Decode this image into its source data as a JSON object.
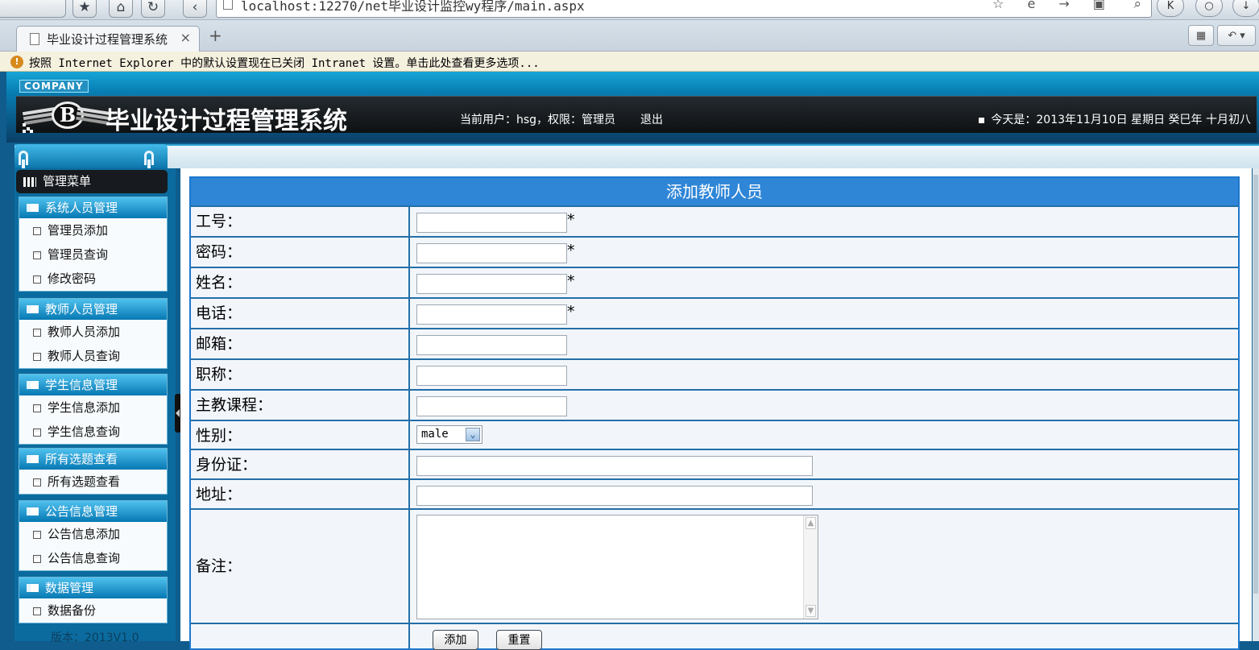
{
  "browser": {
    "url": "localhost:12270/net毕业设计监控wy程序/main.aspx",
    "tab_title": "毕业设计过程管理系统",
    "tab_close": "×",
    "new_tab": "+",
    "infobar_text": "按照 Internet Explorer 中的默认设置现在已关闭 Intranet 设置。单击此处查看更多选项..."
  },
  "header": {
    "company": "COMPANY",
    "logo_letter": "B",
    "title": "毕业设计过程管理系统",
    "user_info": "当前用户：hsg，权限：管理员",
    "logout": "退出",
    "date": "今天是：2013年11月10日 星期日 癸巳年 十月初八"
  },
  "sidebar": {
    "root": "管理菜单",
    "sections": [
      {
        "title": "系统人员管理",
        "items": [
          "管理员添加",
          "管理员查询",
          "修改密码"
        ]
      },
      {
        "title": "教师人员管理",
        "items": [
          "教师人员添加",
          "教师人员查询"
        ]
      },
      {
        "title": "学生信息管理",
        "items": [
          "学生信息添加",
          "学生信息查询"
        ]
      },
      {
        "title": "所有选题查看",
        "items": [
          "所有选题查看"
        ]
      },
      {
        "title": "公告信息管理",
        "items": [
          "公告信息添加",
          "公告信息查询"
        ]
      },
      {
        "title": "数据管理",
        "items": [
          "数据备份"
        ]
      }
    ],
    "version": "版本：2013V1.0"
  },
  "form": {
    "title": "添加教师人员",
    "fields": {
      "gonghao": {
        "label": "工号：",
        "required": "*"
      },
      "mima": {
        "label": "密码：",
        "required": "*"
      },
      "xingming": {
        "label": "姓名：",
        "required": "*"
      },
      "dianhua": {
        "label": "电话：",
        "required": "*"
      },
      "youxiang": {
        "label": "邮箱："
      },
      "zhicheng": {
        "label": "职称："
      },
      "zhujiao": {
        "label": "主教课程："
      },
      "xingbie": {
        "label": "性别：",
        "value": "male"
      },
      "shenfenzheng": {
        "label": "身份证："
      },
      "dizhi": {
        "label": "地址："
      },
      "beizhu": {
        "label": "备注："
      }
    },
    "buttons": {
      "add": "添加",
      "reset": "重置"
    }
  },
  "colors": {
    "form_header": "#2f86d7",
    "sidebar_header": "#0678b3",
    "banner": "#111416"
  }
}
